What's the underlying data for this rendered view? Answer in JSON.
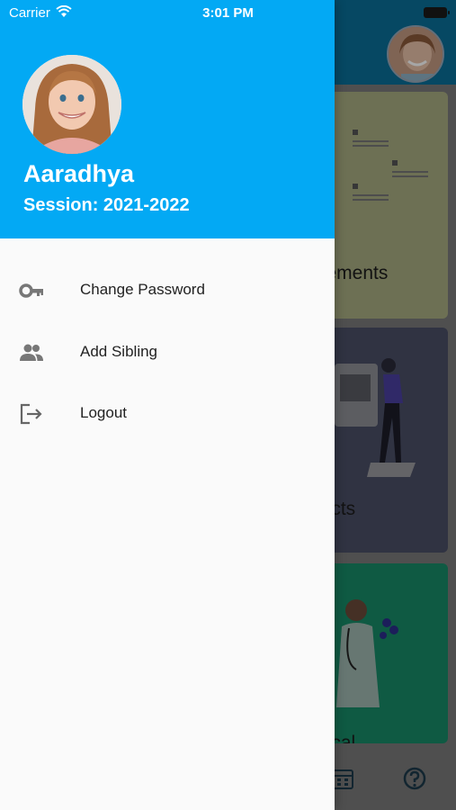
{
  "status_bar": {
    "carrier": "Carrier",
    "time": "3:01 PM"
  },
  "drawer": {
    "header_color": "#03A9F4",
    "profile": {
      "name": "Aaradhya",
      "session": "Session: 2021-2022"
    },
    "menu": [
      {
        "label": "Change Password",
        "icon": "key-icon"
      },
      {
        "label": "Add Sibling",
        "icon": "people-icon"
      },
      {
        "label": "Logout",
        "icon": "logout-icon"
      }
    ]
  },
  "background": {
    "cards": [
      {
        "label": "cements"
      },
      {
        "label": "jects"
      },
      {
        "label": "dical"
      }
    ]
  }
}
